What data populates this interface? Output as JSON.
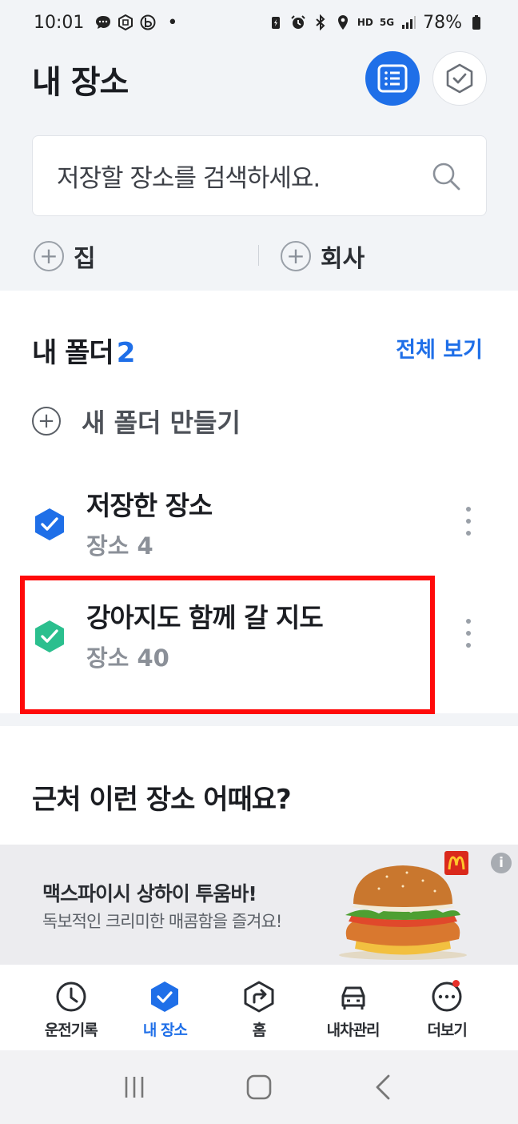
{
  "status_bar": {
    "time": "10:01",
    "battery": "78%",
    "hd_label": "HD",
    "network_label": "5G"
  },
  "header": {
    "title": "내 장소"
  },
  "search": {
    "placeholder": "저장할 장소를 검색하세요."
  },
  "quick": {
    "home_label": "집",
    "company_label": "회사"
  },
  "folders": {
    "title": "내 폴더",
    "count": "2",
    "view_all": "전체 보기",
    "new_folder": "새 폴더 만들기",
    "items": [
      {
        "name": "저장한 장소",
        "count": "장소 4",
        "color": "#1f6fe8"
      },
      {
        "name": "강아지도 함께 갈 지도",
        "count": "장소 40",
        "color": "#2bbf8e"
      }
    ]
  },
  "nearby": {
    "title": "근처 이런 장소 어때요?"
  },
  "ad": {
    "title": "맥스파이시 상하이 투움바!",
    "subtitle": "독보적인 크리미한 매콤함을 즐겨요!",
    "info": "i"
  },
  "bottom_nav": {
    "items": [
      {
        "label": "운전기록",
        "icon": "clock-icon"
      },
      {
        "label": "내 장소",
        "icon": "check-shield-icon"
      },
      {
        "label": "홈",
        "icon": "route-icon"
      },
      {
        "label": "내차관리",
        "icon": "car-icon"
      },
      {
        "label": "더보기",
        "icon": "more-icon"
      }
    ]
  },
  "colors": {
    "accent": "#1f6fe8",
    "folder_green": "#2bbf8e",
    "highlight": "#ff0a0a"
  }
}
